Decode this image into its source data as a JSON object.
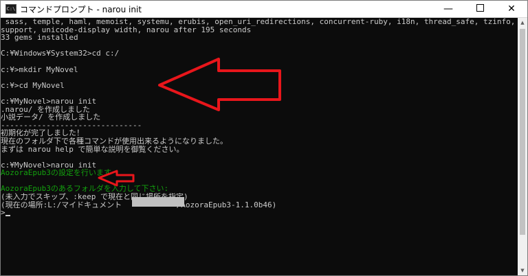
{
  "window": {
    "title": "コマンドプロンプト - narou  init",
    "icon_label": "C:\\",
    "minimize_glyph": "—",
    "close_glyph": "✕"
  },
  "console": {
    "lines": [
      {
        "text": " sass, temple, haml, memoist, systemu, erubis, open_uri_redirections, concurrent-ruby, i18n, thread_safe, tzinfo, active",
        "color": "gray"
      },
      {
        "text": "support, unicode-display_width, narou after 195 seconds",
        "color": "gray"
      },
      {
        "text": "33 gems installed",
        "color": "gray"
      },
      {
        "text": "",
        "color": "gray"
      },
      {
        "text": "C:¥Windows¥System32>cd c:/",
        "color": "gray"
      },
      {
        "text": "",
        "color": "gray"
      },
      {
        "text": "c:¥>mkdir MyNovel",
        "color": "gray"
      },
      {
        "text": "",
        "color": "gray"
      },
      {
        "text": "c:¥>cd MyNovel",
        "color": "gray"
      },
      {
        "text": "",
        "color": "gray"
      },
      {
        "text": "c:¥MyNovel>narou init",
        "color": "gray"
      },
      {
        "text": ".narou/ を作成しました",
        "color": "gray"
      },
      {
        "text": "小説データ/ を作成しました",
        "color": "gray"
      },
      {
        "text": "-------------------------------",
        "color": "gray"
      },
      {
        "text": "初期化が完了しました！",
        "color": "gray"
      },
      {
        "text": "現在のフォルダ下で各種コマンドが使用出来るようになりました。",
        "color": "gray"
      },
      {
        "text": "まずは narou help で簡単な説明を御覧ください。",
        "color": "gray"
      },
      {
        "text": "",
        "color": "gray"
      },
      {
        "text": "c:¥MyNovel>narou init",
        "color": "gray"
      },
      {
        "text": "AozoraEpub3の設定を行います",
        "color": "green"
      },
      {
        "text": "",
        "color": "gray"
      },
      {
        "text": "AozoraEpub3のあるフォルダを入力して下さい:",
        "color": "green"
      },
      {
        "text": "(未入力でスキップ、:keep で現在と同じ場所を指定)",
        "color": "gray"
      },
      {
        "text": "(現在の場所:L:/マイドキュメント            /AozoraEpub3-1.1.0b46)",
        "color": "gray"
      },
      {
        "text": ">",
        "color": "gray",
        "cursor": true
      }
    ]
  },
  "colors": {
    "console_bg": "#0c0c0c",
    "console_fg": "#cccccc",
    "green_text": "#13a10e",
    "annotation_red": "#e8161b",
    "titlebar_bg": "#ffffff"
  },
  "icons": {
    "scroll_up": "scroll-up-arrow-icon",
    "scroll_down": "scroll-down-arrow-icon",
    "minimize": "minimize-icon",
    "maximize": "maximize-icon",
    "close": "close-icon"
  }
}
